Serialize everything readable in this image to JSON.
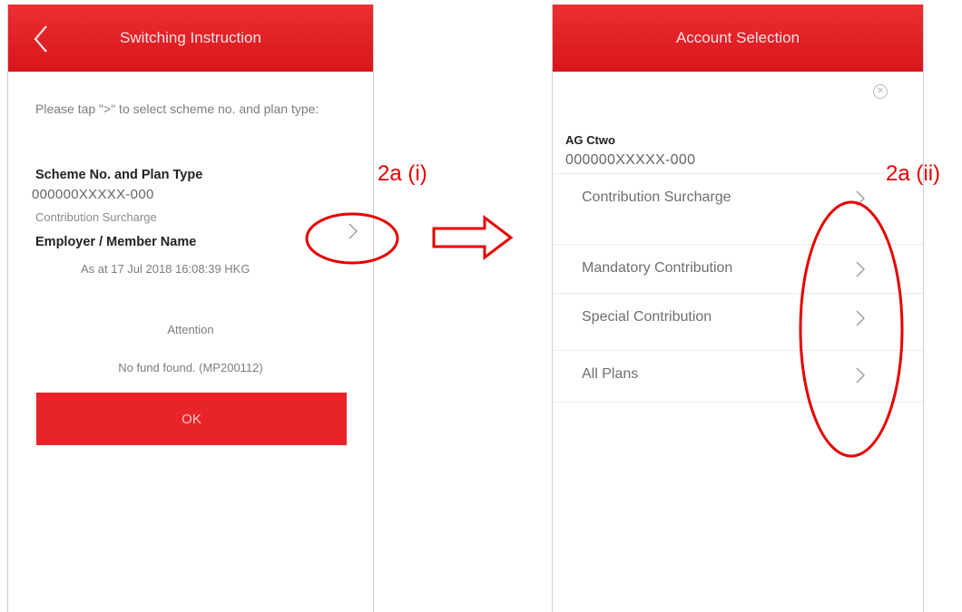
{
  "left_screen": {
    "title": "Switching Instruction",
    "instruction": "Please tap \">\" to select scheme no. and plan type:",
    "scheme_label": "Scheme No. and Plan Type",
    "scheme_number": "000000XXXXX-000",
    "plan_type": "Contribution Surcharge",
    "employer_label": "Employer / Member Name",
    "as_at": "As at 17 Jul 2018 16:08:39 HKG",
    "attention": "Attention",
    "message": "No fund found. (MP200112)",
    "ok_label": "OK"
  },
  "right_screen": {
    "title": "Account Selection",
    "account_name": "AG Ctwo",
    "account_number": "000000XXXXX-000",
    "items": [
      {
        "label": "Contribution Surcharge"
      },
      {
        "label": "Mandatory Contribution"
      },
      {
        "label": "Special Contribution"
      },
      {
        "label": "All Plans"
      }
    ]
  },
  "annotations": {
    "left_callout": "2a (i)",
    "right_callout": "2a (ii)",
    "color": "#e60000"
  },
  "colors": {
    "brand_red": "#e8242a"
  }
}
